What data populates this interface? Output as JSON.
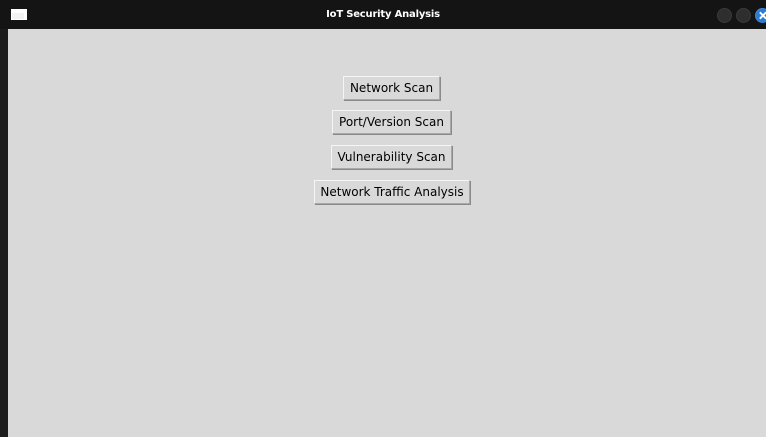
{
  "window": {
    "title": "IoT Security Analysis",
    "icon": "app-window-icon",
    "controls": [
      "minimize-icon",
      "maximize-icon",
      "close-icon"
    ],
    "accent_color": "#2a7bd6",
    "background_color": "#d9d9d9"
  },
  "main": {
    "buttons": [
      {
        "label": "Network Scan"
      },
      {
        "label": "Port/Version Scan"
      },
      {
        "label": "Vulnerability Scan"
      },
      {
        "label": "Network Traffic Analysis"
      }
    ]
  }
}
